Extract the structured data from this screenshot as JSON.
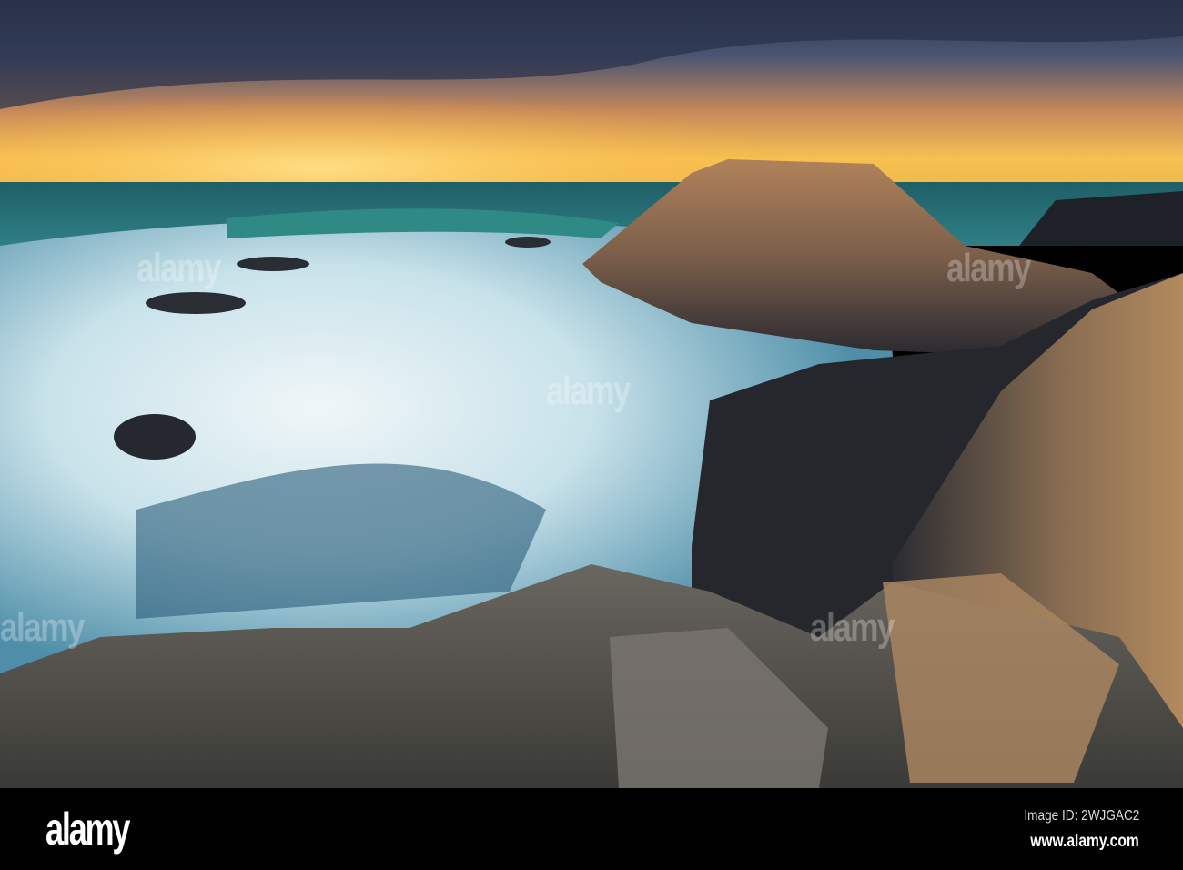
{
  "photo": {
    "subject": "Basalt columns at a rocky coast with crashing waves at sunset",
    "watermark_text": "alamy"
  },
  "footer": {
    "logo": "alamy",
    "image_id": "Image ID: 2WJGAC2",
    "website": "www.alamy.com"
  }
}
